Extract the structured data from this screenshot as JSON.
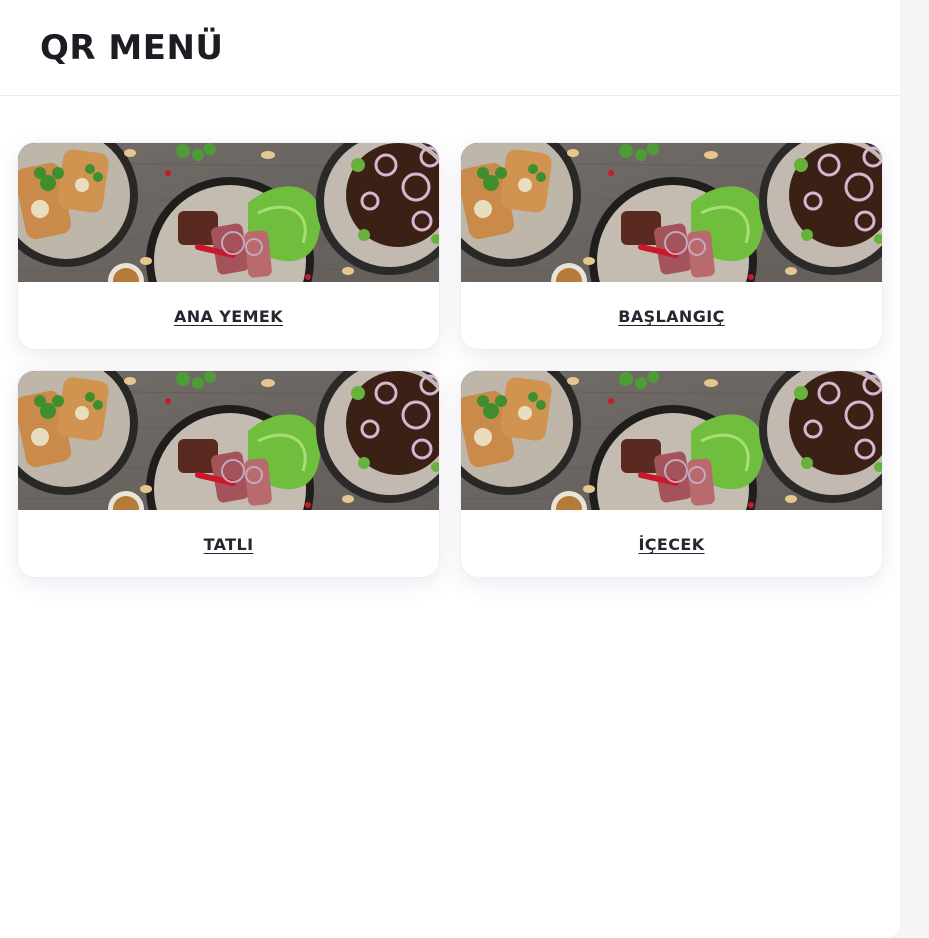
{
  "header": {
    "title": "QR MENÜ"
  },
  "categories": [
    {
      "label": "ANA YEMEK"
    },
    {
      "label": "BAŞLANGIÇ"
    },
    {
      "label": "TATLI"
    },
    {
      "label": "İÇECEK"
    }
  ],
  "colors": {
    "page_background": "#f4f5f7",
    "panel": "#ffffff",
    "title_text": "#1c1c22",
    "link_text": "#2a2430",
    "wood": "#6f6a66"
  },
  "card_image_description": "food-photo"
}
